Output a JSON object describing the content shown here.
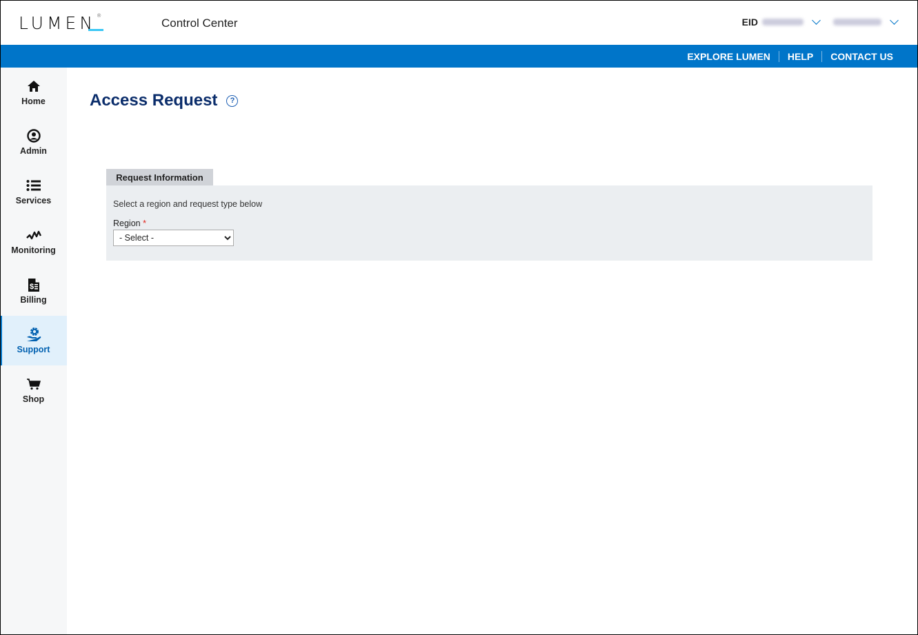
{
  "header": {
    "logo_text": "LUMEN",
    "logo_reg": "®",
    "app_title": "Control Center",
    "eid_label": "EID",
    "eid_value_blurred": true,
    "username_blurred": true
  },
  "utility_nav": {
    "links": [
      "EXPLORE LUMEN",
      "HELP",
      "CONTACT US"
    ]
  },
  "sidebar": {
    "items": [
      {
        "label": "Home",
        "icon": "home-icon"
      },
      {
        "label": "Admin",
        "icon": "user-circle-icon"
      },
      {
        "label": "Services",
        "icon": "list-icon"
      },
      {
        "label": "Monitoring",
        "icon": "pulse-icon"
      },
      {
        "label": "Billing",
        "icon": "invoice-icon"
      },
      {
        "label": "Support",
        "icon": "support-gear-hand-icon",
        "active": true
      },
      {
        "label": "Shop",
        "icon": "cart-icon"
      }
    ]
  },
  "main": {
    "title": "Access Request",
    "tab_label": "Request Information",
    "description": "Select a region and request type below",
    "region_label": "Region",
    "required_marker": "*",
    "region_select_value": "- Select -"
  },
  "colors": {
    "brand_blue": "#0075c9",
    "title_navy": "#0b2d6b",
    "logo_accent": "#38c6f4"
  }
}
